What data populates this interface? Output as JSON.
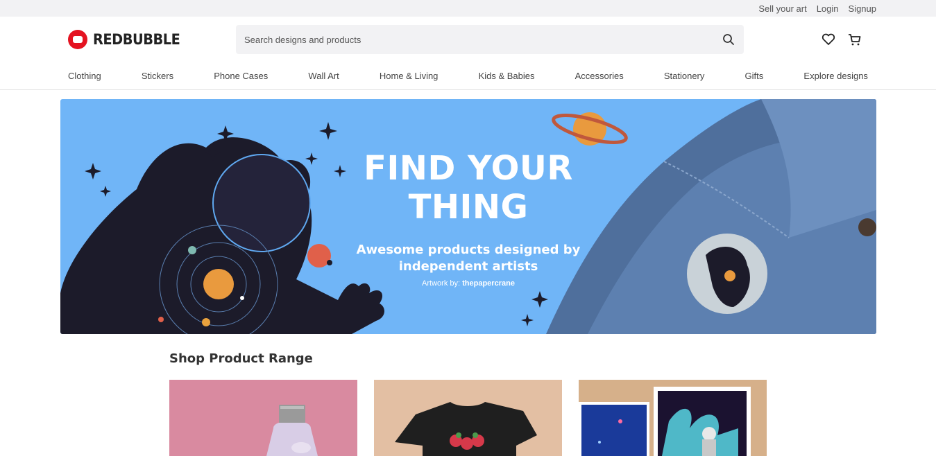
{
  "topbar": {
    "sell": "Sell your art",
    "login": "Login",
    "signup": "Signup"
  },
  "brand": {
    "name": "REDBUBBLE",
    "color": "#e41321"
  },
  "search": {
    "placeholder": "Search designs and products"
  },
  "icons": {
    "search": "search-icon",
    "wishlist": "heart-icon",
    "cart": "cart-icon"
  },
  "nav": [
    "Clothing",
    "Stickers",
    "Phone Cases",
    "Wall Art",
    "Home & Living",
    "Kids & Babies",
    "Accessories",
    "Stationery",
    "Gifts",
    "Explore designs"
  ],
  "hero": {
    "title_line1": "FIND YOUR",
    "title_line2": "THING",
    "subtitle_line1": "Awesome products designed by",
    "subtitle_line2": "independent artists",
    "credit_prefix": "Artwork by:",
    "credit_artist": "thepapercrane",
    "background": "#70b5f7"
  },
  "section": {
    "title": "Shop Product Range"
  },
  "products": [
    {
      "name": "water-bottle",
      "bg": "#d98aa0"
    },
    {
      "name": "t-shirt",
      "bg": "#e3bfa3"
    },
    {
      "name": "wall-art",
      "bg": "#d6b08a"
    }
  ]
}
